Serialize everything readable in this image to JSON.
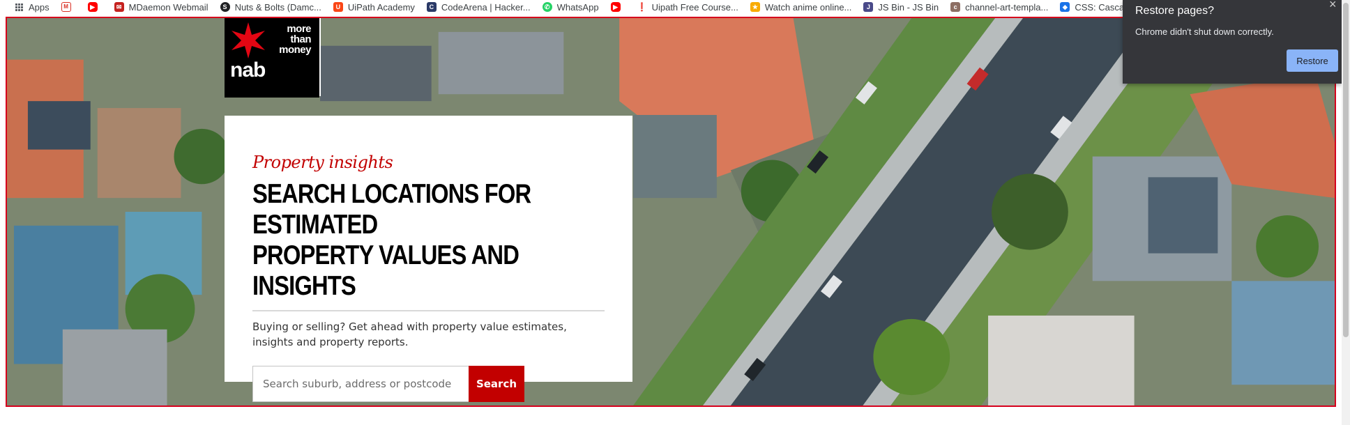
{
  "browser": {
    "bookmarks": [
      {
        "label": "Apps",
        "icon": "apps-grid-icon"
      },
      {
        "label": "",
        "icon": "gmail-icon",
        "color": "#d93025"
      },
      {
        "label": "",
        "icon": "youtube-icon",
        "color": "#ff0000"
      },
      {
        "label": "MDaemon Webmail",
        "icon": "mdaemon-icon",
        "color": "#c5221f"
      },
      {
        "label": "Nuts & Bolts (Damc...",
        "icon": "nuts-bolts-icon",
        "color": "#202124"
      },
      {
        "label": "UiPath Academy",
        "icon": "uipath-icon",
        "color": "#fa4616"
      },
      {
        "label": "CodeArena | Hacker...",
        "icon": "codearena-icon",
        "color": "#2b3a67"
      },
      {
        "label": "WhatsApp",
        "icon": "whatsapp-icon",
        "color": "#25d366"
      },
      {
        "label": "",
        "icon": "youtube-icon",
        "color": "#ff0000"
      },
      {
        "label": "Uipath Free Course...",
        "icon": "pin-icon",
        "color": "#e8710a"
      },
      {
        "label": "Watch anime online...",
        "icon": "anime-icon",
        "color": "#f9ab00"
      },
      {
        "label": "JS Bin - JS Bin",
        "icon": "jsbin-icon",
        "color": "#4a4a8a"
      },
      {
        "label": "channel-art-templa...",
        "icon": "channel-art-icon",
        "color": "#8d6e63"
      },
      {
        "label": "CSS: Cascading Styl...",
        "icon": "css-icon",
        "color": "#1a73e8"
      },
      {
        "label": "",
        "icon": "bookmark-icon",
        "color": "#fbbc04"
      }
    ]
  },
  "hero": {
    "logo": {
      "wordmark": "nab",
      "tagline_1": "more",
      "tagline_2": "than",
      "tagline_3": "money",
      "star_color": "#e30613"
    },
    "kicker": "Property insights",
    "headline_1": "SEARCH LOCATIONS FOR ESTIMATED",
    "headline_2": "PROPERTY VALUES AND INSIGHTS",
    "description": "Buying or selling? Get ahead with property value estimates, insights and property reports.",
    "search": {
      "placeholder": "Search suburb, address or postcode",
      "value": "",
      "button": "Search"
    }
  },
  "restore_popup": {
    "title": "Restore pages?",
    "message": "Chrome didn't shut down correctly.",
    "button": "Restore",
    "close": "×"
  },
  "colors": {
    "brand_red": "#c20000",
    "popup_bg": "#35363a",
    "popup_button": "#8ab4f8"
  }
}
